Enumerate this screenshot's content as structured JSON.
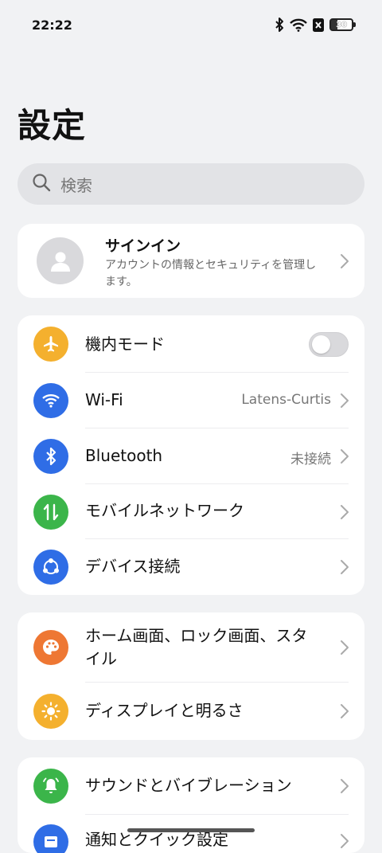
{
  "status_bar": {
    "time": "22:22",
    "battery": "30"
  },
  "page": {
    "title": "設定"
  },
  "search": {
    "placeholder": "検索"
  },
  "account": {
    "title": "サインイン",
    "subtitle": "アカウントの情報とセキュリティを管理します。"
  },
  "connectivity": {
    "airplane": {
      "label": "機内モード",
      "enabled": false
    },
    "wifi": {
      "label": "Wi-Fi",
      "value": "Latens-Curtis"
    },
    "bluetooth": {
      "label": "Bluetooth",
      "value": "未接続"
    },
    "mobile": {
      "label": "モバイルネットワーク"
    },
    "device": {
      "label": "デバイス接続"
    }
  },
  "personalization": {
    "home": {
      "label": "ホーム画面、ロック画面、スタイル"
    },
    "display": {
      "label": "ディスプレイと明るさ"
    }
  },
  "sound_section": {
    "sound": {
      "label": "サウンドとバイブレーション"
    },
    "notifications": {
      "label": "通知とクイック設定"
    }
  },
  "colors": {
    "airplane": "#f4b02e",
    "wifi": "#2f6de6",
    "bluetooth": "#2f6de6",
    "mobile": "#3bb54a",
    "device": "#2f6de6",
    "home": "#ee7733",
    "display": "#f4b02e",
    "sound": "#3bb54a",
    "notifications": "#2f6de6"
  }
}
